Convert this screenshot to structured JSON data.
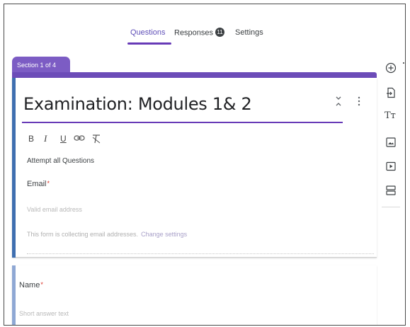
{
  "tabs": {
    "questions": "Questions",
    "responses": "Responses",
    "responses_count": "11",
    "settings": "Settings"
  },
  "section_label": "Section 1 of 4",
  "form": {
    "title": "Examination: Modules 1& 2",
    "description": "Attempt all Questions"
  },
  "formatting": {
    "bold": "B",
    "italic": "I",
    "underline": "U"
  },
  "email_question": {
    "label": "Email",
    "required_mark": "*",
    "placeholder": "Valid email address",
    "collect_note": "This form is collecting email addresses.",
    "change_link": "Change settings"
  },
  "name_question": {
    "label": "Name",
    "required_mark": "*",
    "placeholder": "Short answer text"
  },
  "toolbar": {
    "title_glyph": "Tт"
  },
  "colors": {
    "accent": "#673ab7",
    "section_chip": "#7c5cc4",
    "card_border": "#3f6fb0",
    "required": "#d93025"
  }
}
